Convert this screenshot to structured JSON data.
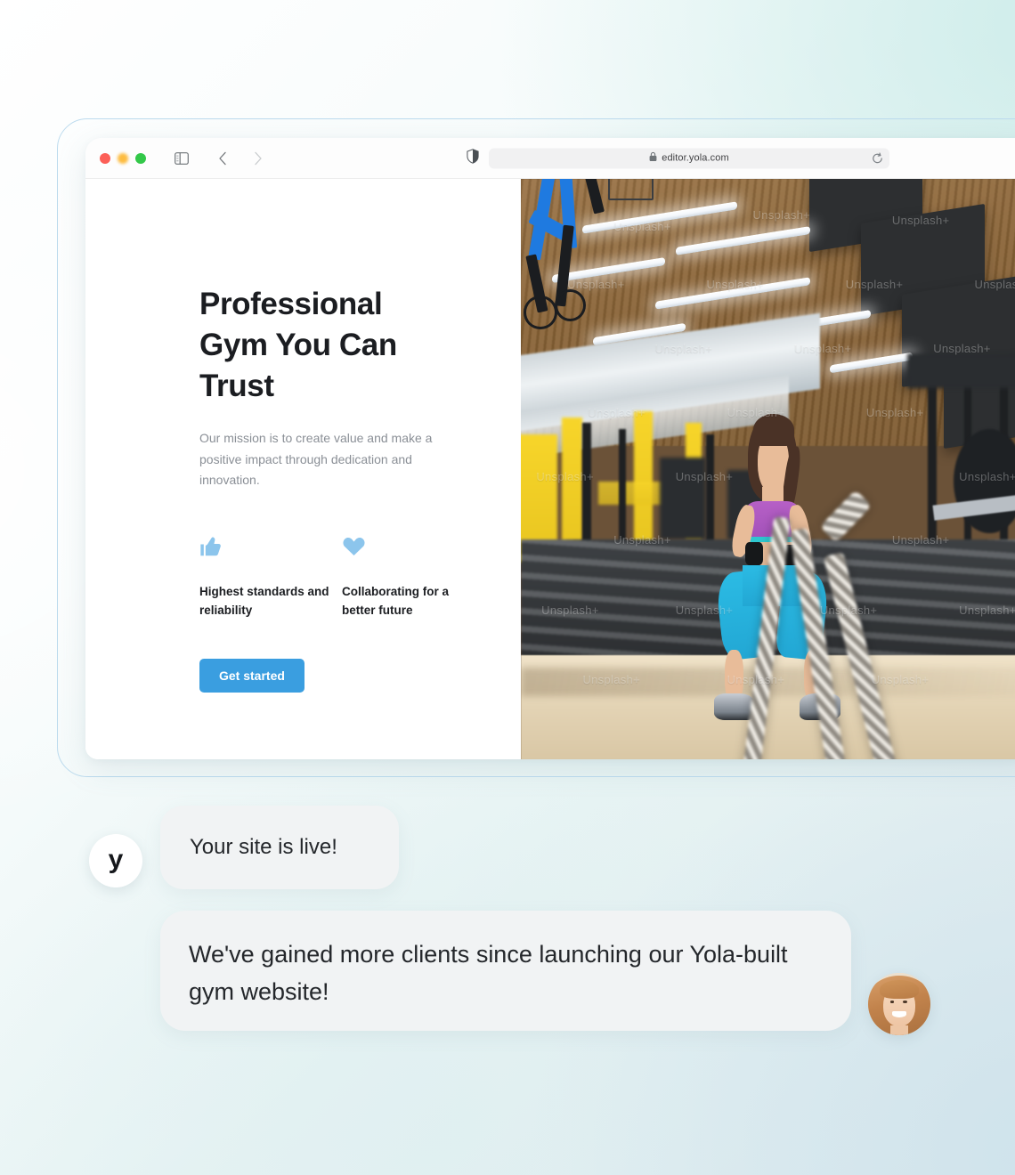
{
  "browser": {
    "traffic_lights": [
      "close",
      "minimize",
      "maximize"
    ],
    "sidebar_toggle_icon": "sidebar-toggle-icon",
    "back_icon": "chevron-left-icon",
    "forward_icon": "chevron-right-icon",
    "shield_icon": "privacy-shield-icon",
    "lock_icon": "lock-icon",
    "url": "editor.yola.com",
    "reload_icon": "reload-icon"
  },
  "site": {
    "title": "Professional Gym You Can Trust",
    "subtitle": "Our mission is to create value and make a positive impact through dedication and innovation.",
    "features": [
      {
        "icon": "thumbs-up-icon",
        "label": "Highest standards and reliability"
      },
      {
        "icon": "heart-icon",
        "label": "Collaborating for a better future"
      }
    ],
    "cta_label": "Get started",
    "photo": {
      "alt": "Woman training with battle ropes in an industrial gym",
      "watermark": "Unsplash+"
    }
  },
  "chat": {
    "brand_avatar_glyph": "y",
    "messages": [
      {
        "sender": "yola",
        "text": "Your site is live!"
      },
      {
        "sender": "client",
        "text": "We've gained more clients since launching our Yola-built gym website!"
      }
    ],
    "client_avatar": "client-photo-avatar"
  },
  "colors": {
    "accent_blue": "#3a9ee0",
    "icon_blue": "#8cc5ec",
    "text_dark": "#1b1d21",
    "text_muted": "#8a8f96",
    "bubble_gray": "#f1f3f4",
    "frame_stroke": "#bcdbee"
  }
}
